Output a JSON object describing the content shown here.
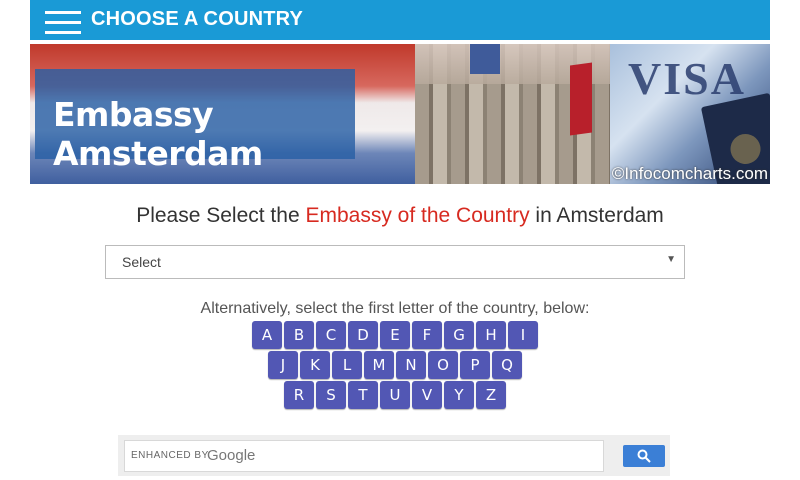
{
  "header": {
    "title": "CHOOSE A COUNTRY"
  },
  "banner": {
    "title": "Embassy Amsterdam",
    "watermark": "©Infocomcharts.com",
    "visa_text": "VISA"
  },
  "main": {
    "heading_prefix": "Please Select the ",
    "heading_highlight": "Embassy of the Country",
    "heading_suffix": " in Amsterdam",
    "select_value": "Select",
    "alt_text": "Alternatively, select the first letter of the country, below:",
    "letters_row1": [
      "A",
      "B",
      "C",
      "D",
      "E",
      "F",
      "G",
      "H",
      "I"
    ],
    "letters_row2": [
      "J",
      "K",
      "L",
      "M",
      "N",
      "O",
      "P",
      "Q"
    ],
    "letters_row3": [
      "R",
      "S",
      "T",
      "U",
      "V",
      "Y",
      "Z"
    ]
  },
  "search": {
    "label": "ENHANCED BY",
    "brand": "Google"
  },
  "colors": {
    "topbar": "#1a9ad6",
    "letter_button": "#5257b4",
    "highlight": "#d72a20",
    "search_button": "#3b7fd6"
  }
}
